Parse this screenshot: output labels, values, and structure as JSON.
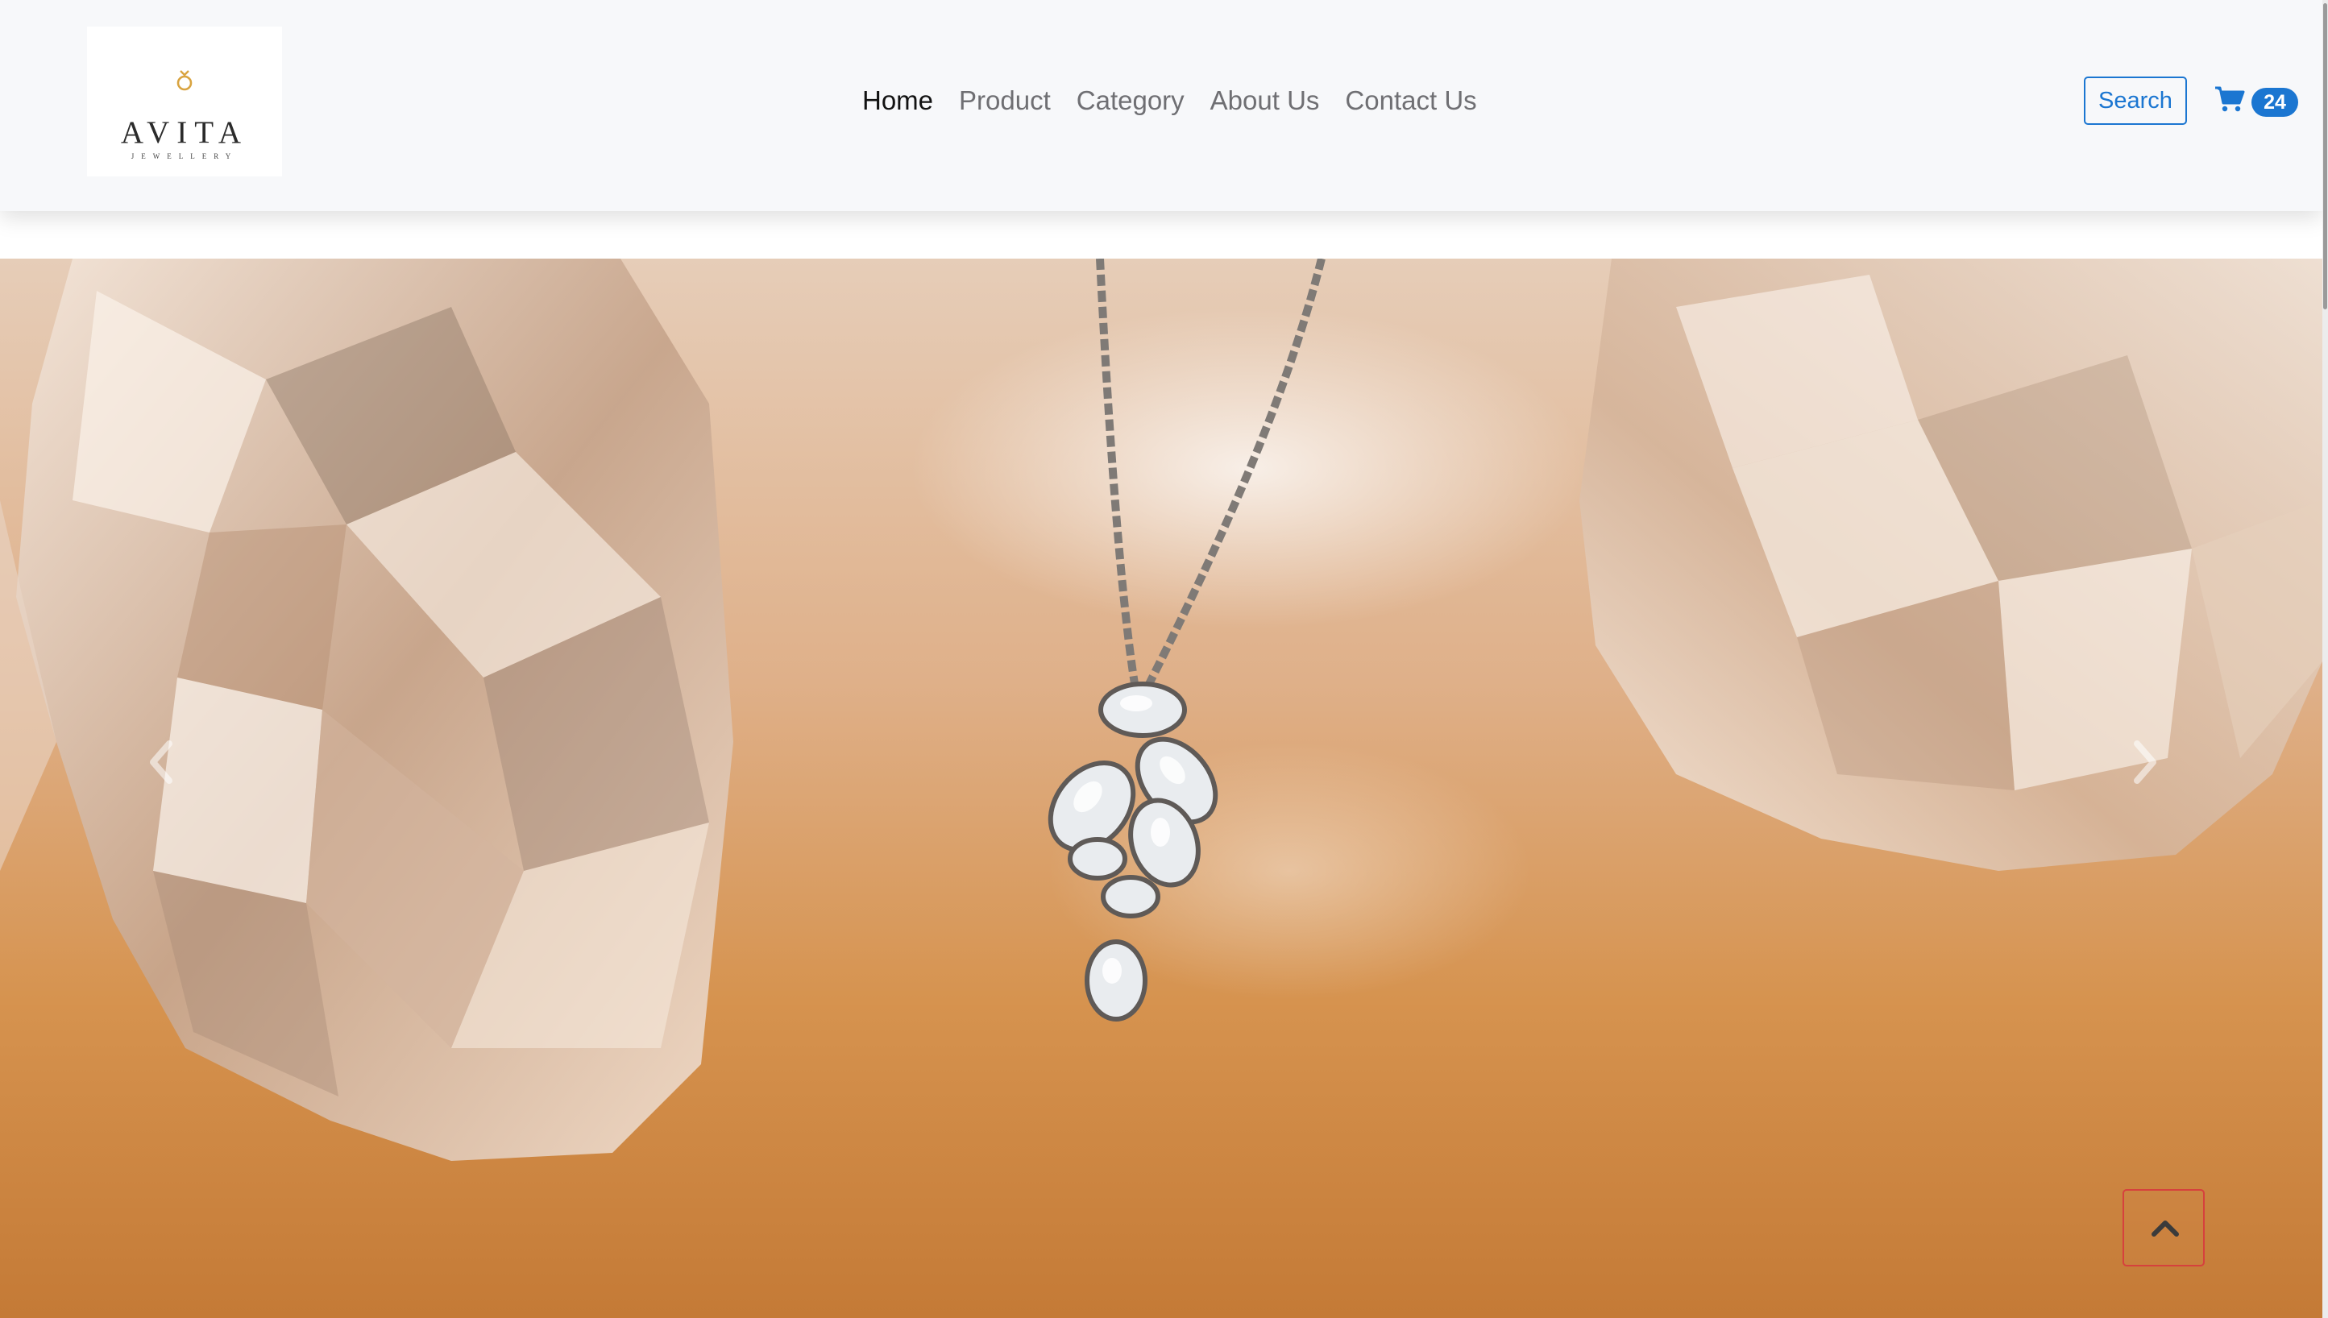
{
  "brand": {
    "name": "AVITA",
    "tagline": "JEWELLERY",
    "accent_color": "#d9a441"
  },
  "nav": {
    "links": [
      {
        "label": "Home",
        "active": true
      },
      {
        "label": "Product",
        "active": false
      },
      {
        "label": "Category",
        "active": false
      },
      {
        "label": "About Us",
        "active": false
      },
      {
        "label": "Contact Us",
        "active": false
      }
    ]
  },
  "header": {
    "search_label": "Search",
    "cart_icon": "cart-icon",
    "cart_count": "24",
    "primary_color": "#1b76d1"
  },
  "hero": {
    "image": "pendant-necklace-with-crystals",
    "prev_icon": "chevron-left-icon",
    "next_icon": "chevron-right-icon"
  },
  "scroll_top": {
    "icon": "chevron-up-icon",
    "border_color": "#d6413d"
  }
}
